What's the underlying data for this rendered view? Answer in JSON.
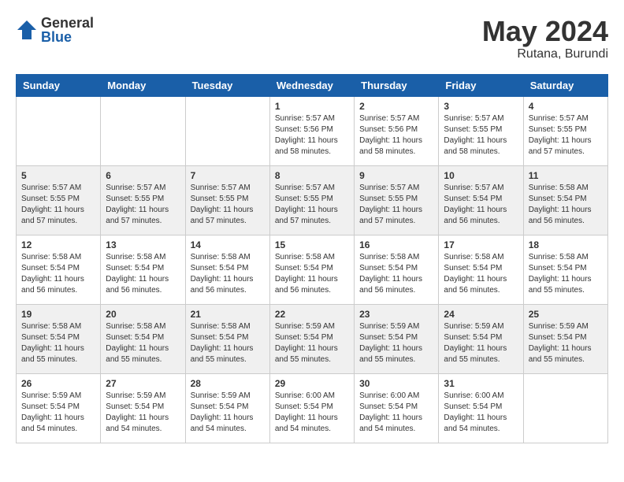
{
  "header": {
    "logo_general": "General",
    "logo_blue": "Blue",
    "month_year": "May 2024",
    "location": "Rutana, Burundi"
  },
  "calendar": {
    "days_of_week": [
      "Sunday",
      "Monday",
      "Tuesday",
      "Wednesday",
      "Thursday",
      "Friday",
      "Saturday"
    ],
    "weeks": [
      [
        {
          "day": "",
          "info": ""
        },
        {
          "day": "",
          "info": ""
        },
        {
          "day": "",
          "info": ""
        },
        {
          "day": "1",
          "info": "Sunrise: 5:57 AM\nSunset: 5:56 PM\nDaylight: 11 hours\nand 58 minutes."
        },
        {
          "day": "2",
          "info": "Sunrise: 5:57 AM\nSunset: 5:56 PM\nDaylight: 11 hours\nand 58 minutes."
        },
        {
          "day": "3",
          "info": "Sunrise: 5:57 AM\nSunset: 5:55 PM\nDaylight: 11 hours\nand 58 minutes."
        },
        {
          "day": "4",
          "info": "Sunrise: 5:57 AM\nSunset: 5:55 PM\nDaylight: 11 hours\nand 57 minutes."
        }
      ],
      [
        {
          "day": "5",
          "info": "Sunrise: 5:57 AM\nSunset: 5:55 PM\nDaylight: 11 hours\nand 57 minutes."
        },
        {
          "day": "6",
          "info": "Sunrise: 5:57 AM\nSunset: 5:55 PM\nDaylight: 11 hours\nand 57 minutes."
        },
        {
          "day": "7",
          "info": "Sunrise: 5:57 AM\nSunset: 5:55 PM\nDaylight: 11 hours\nand 57 minutes."
        },
        {
          "day": "8",
          "info": "Sunrise: 5:57 AM\nSunset: 5:55 PM\nDaylight: 11 hours\nand 57 minutes."
        },
        {
          "day": "9",
          "info": "Sunrise: 5:57 AM\nSunset: 5:55 PM\nDaylight: 11 hours\nand 57 minutes."
        },
        {
          "day": "10",
          "info": "Sunrise: 5:57 AM\nSunset: 5:54 PM\nDaylight: 11 hours\nand 56 minutes."
        },
        {
          "day": "11",
          "info": "Sunrise: 5:58 AM\nSunset: 5:54 PM\nDaylight: 11 hours\nand 56 minutes."
        }
      ],
      [
        {
          "day": "12",
          "info": "Sunrise: 5:58 AM\nSunset: 5:54 PM\nDaylight: 11 hours\nand 56 minutes."
        },
        {
          "day": "13",
          "info": "Sunrise: 5:58 AM\nSunset: 5:54 PM\nDaylight: 11 hours\nand 56 minutes."
        },
        {
          "day": "14",
          "info": "Sunrise: 5:58 AM\nSunset: 5:54 PM\nDaylight: 11 hours\nand 56 minutes."
        },
        {
          "day": "15",
          "info": "Sunrise: 5:58 AM\nSunset: 5:54 PM\nDaylight: 11 hours\nand 56 minutes."
        },
        {
          "day": "16",
          "info": "Sunrise: 5:58 AM\nSunset: 5:54 PM\nDaylight: 11 hours\nand 56 minutes."
        },
        {
          "day": "17",
          "info": "Sunrise: 5:58 AM\nSunset: 5:54 PM\nDaylight: 11 hours\nand 56 minutes."
        },
        {
          "day": "18",
          "info": "Sunrise: 5:58 AM\nSunset: 5:54 PM\nDaylight: 11 hours\nand 55 minutes."
        }
      ],
      [
        {
          "day": "19",
          "info": "Sunrise: 5:58 AM\nSunset: 5:54 PM\nDaylight: 11 hours\nand 55 minutes."
        },
        {
          "day": "20",
          "info": "Sunrise: 5:58 AM\nSunset: 5:54 PM\nDaylight: 11 hours\nand 55 minutes."
        },
        {
          "day": "21",
          "info": "Sunrise: 5:58 AM\nSunset: 5:54 PM\nDaylight: 11 hours\nand 55 minutes."
        },
        {
          "day": "22",
          "info": "Sunrise: 5:59 AM\nSunset: 5:54 PM\nDaylight: 11 hours\nand 55 minutes."
        },
        {
          "day": "23",
          "info": "Sunrise: 5:59 AM\nSunset: 5:54 PM\nDaylight: 11 hours\nand 55 minutes."
        },
        {
          "day": "24",
          "info": "Sunrise: 5:59 AM\nSunset: 5:54 PM\nDaylight: 11 hours\nand 55 minutes."
        },
        {
          "day": "25",
          "info": "Sunrise: 5:59 AM\nSunset: 5:54 PM\nDaylight: 11 hours\nand 55 minutes."
        }
      ],
      [
        {
          "day": "26",
          "info": "Sunrise: 5:59 AM\nSunset: 5:54 PM\nDaylight: 11 hours\nand 54 minutes."
        },
        {
          "day": "27",
          "info": "Sunrise: 5:59 AM\nSunset: 5:54 PM\nDaylight: 11 hours\nand 54 minutes."
        },
        {
          "day": "28",
          "info": "Sunrise: 5:59 AM\nSunset: 5:54 PM\nDaylight: 11 hours\nand 54 minutes."
        },
        {
          "day": "29",
          "info": "Sunrise: 6:00 AM\nSunset: 5:54 PM\nDaylight: 11 hours\nand 54 minutes."
        },
        {
          "day": "30",
          "info": "Sunrise: 6:00 AM\nSunset: 5:54 PM\nDaylight: 11 hours\nand 54 minutes."
        },
        {
          "day": "31",
          "info": "Sunrise: 6:00 AM\nSunset: 5:54 PM\nDaylight: 11 hours\nand 54 minutes."
        },
        {
          "day": "",
          "info": ""
        }
      ]
    ]
  }
}
